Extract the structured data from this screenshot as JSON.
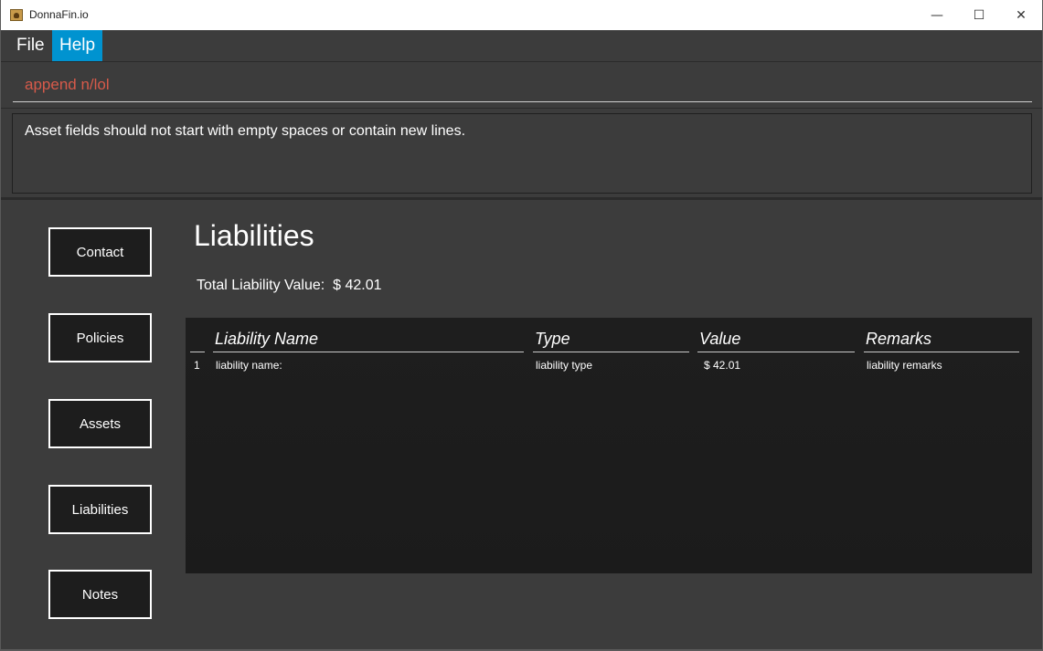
{
  "window": {
    "title": "DonnaFin.io",
    "minimize_glyph": "—",
    "maximize_glyph": "☐",
    "close_glyph": "✕"
  },
  "menu": {
    "items": [
      {
        "label": "File"
      },
      {
        "label": "Help"
      }
    ]
  },
  "command": {
    "value": "append n/lol",
    "error_color": "#d75a4a"
  },
  "result": {
    "message": "Asset fields should not start with empty spaces or contain new lines."
  },
  "nav": {
    "buttons": [
      {
        "label": "Contact"
      },
      {
        "label": "Policies"
      },
      {
        "label": "Assets"
      },
      {
        "label": "Liabilities"
      },
      {
        "label": "Notes"
      }
    ]
  },
  "main": {
    "heading": "Liabilities",
    "total_label": "Total Liability Value:",
    "total_value": "$ 42.01"
  },
  "table": {
    "columns": [
      "",
      "Liability Name",
      "Type",
      "Value",
      "Remarks"
    ],
    "rows": [
      {
        "index": "1",
        "name": "liability name:",
        "type": "liability type",
        "value": "$ 42.01",
        "remarks": "liability remarks"
      }
    ]
  },
  "colors": {
    "accent": "#0093d0",
    "background": "#3c3c3c",
    "table_background": "#1e1e1e"
  }
}
